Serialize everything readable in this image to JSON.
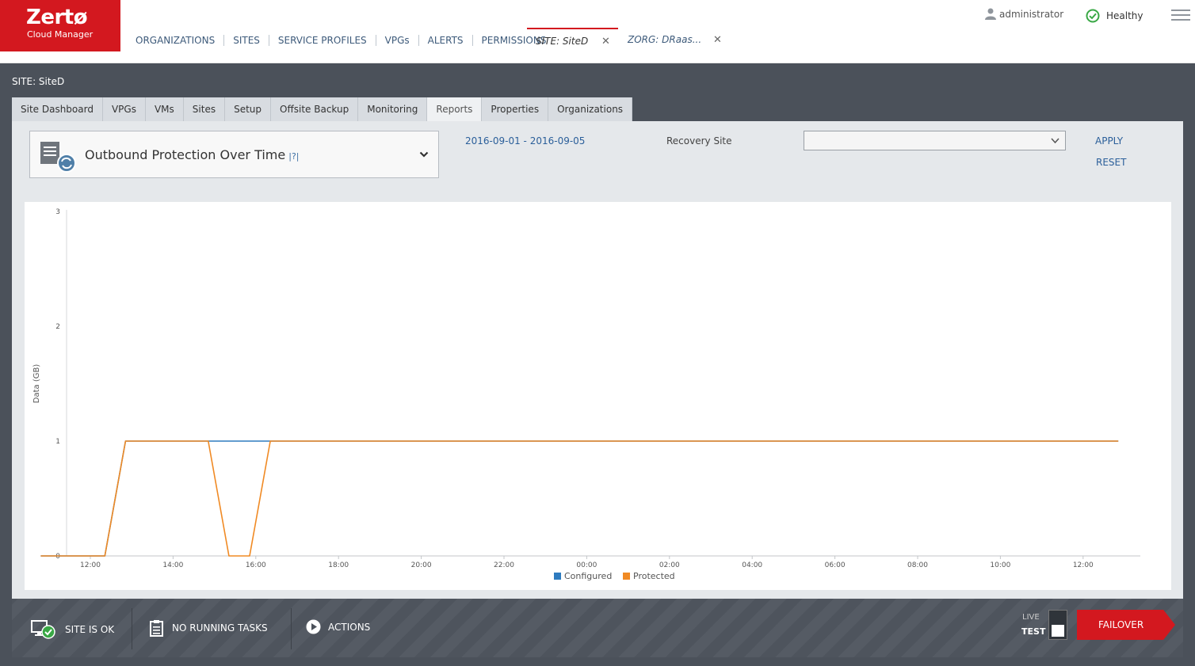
{
  "app": {
    "brand": "Zertø",
    "subtitle": "Cloud Manager"
  },
  "nav": {
    "items": [
      "ORGANIZATIONS",
      "SITES",
      "SERVICE PROFILES",
      "VPGs",
      "ALERTS",
      "PERMISSIONS"
    ]
  },
  "open_tabs": [
    {
      "label": "SITE: SiteD",
      "active": true
    },
    {
      "label": "ZORG: DRaas...",
      "active": false
    }
  ],
  "close_glyph": "✕",
  "user": {
    "name": "administrator"
  },
  "health": {
    "label": "Healthy",
    "color": "#39a845"
  },
  "site": {
    "label": "SITE: SiteD"
  },
  "site_tabs": [
    "Site Dashboard",
    "VPGs",
    "VMs",
    "Sites",
    "Setup",
    "Offsite Backup",
    "Monitoring",
    "Reports",
    "Properties",
    "Organizations"
  ],
  "active_site_tab": "Reports",
  "report": {
    "title": "Outbound Protection Over Time",
    "help": "|?|",
    "date_range": "2016-09-01 - 2016-09-05",
    "recovery_site_label": "Recovery Site",
    "recovery_site_value": "",
    "apply_label": "APPLY",
    "reset_label": "RESET"
  },
  "chart_data": {
    "type": "line",
    "title": "",
    "xlabel": "",
    "ylabel": "Data (GB)",
    "ylim": [
      0,
      3
    ],
    "yticks": [
      "0",
      "1",
      "2",
      "3"
    ],
    "xticks": [
      "12:00",
      "14:00",
      "16:00",
      "18:00",
      "20:00",
      "22:00",
      "00:00",
      "02:00",
      "04:00",
      "06:00",
      "08:00",
      "10:00",
      "12:00"
    ],
    "x_hours_note": "x values are hours relative to the 12:00 tick on the first day",
    "xlim": [
      -1.2,
      24.85
    ],
    "legend_position": "bottom",
    "grid": false,
    "series": [
      {
        "name": "Configured",
        "color": "#2e7bbf",
        "x": [
          -1.2,
          0.35,
          0.85,
          27.0
        ],
        "y": [
          0,
          0,
          1,
          1
        ],
        "xs": [
          -1.2,
          0.35,
          0.85,
          24.85
        ],
        "ys": [
          0,
          0,
          1,
          1
        ]
      },
      {
        "name": "Protected",
        "color": "#f08a24",
        "xs": [
          -1.2,
          0.35,
          0.85,
          2.85,
          3.35,
          3.85,
          4.35,
          24.85
        ],
        "ys": [
          0,
          0,
          1,
          1,
          0,
          0,
          1,
          1
        ]
      }
    ]
  },
  "footer": {
    "status": "SITE IS OK",
    "tasks": "NO RUNNING TASKS",
    "actions": "ACTIONS",
    "live": "LIVE",
    "test": "TEST",
    "failover": "FAILOVER"
  }
}
